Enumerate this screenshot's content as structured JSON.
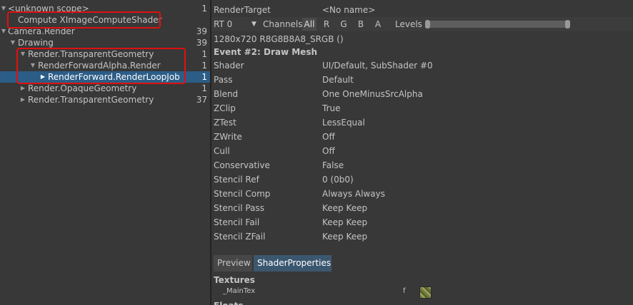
{
  "hierarchy": {
    "rows": [
      {
        "label": "<unknown scope>",
        "count": "1",
        "arrow": "▼"
      },
      {
        "label": "Compute XImageComputeShader",
        "count": "",
        "arrow": ""
      },
      {
        "label": "Camera.Render",
        "count": "39",
        "arrow": "▼"
      },
      {
        "label": "Drawing",
        "count": "39",
        "arrow": "▼"
      },
      {
        "label": "Render.TransparentGeometry",
        "count": "1",
        "arrow": "▼"
      },
      {
        "label": "RenderForwardAlpha.Render",
        "count": "1",
        "arrow": "▼"
      },
      {
        "label": "RenderForward.RenderLoopJob",
        "count": "1",
        "arrow": "▶"
      },
      {
        "label": "Render.OpaqueGeometry",
        "count": "1",
        "arrow": "▶"
      },
      {
        "label": "Render.TransparentGeometry",
        "count": "37",
        "arrow": "▶"
      }
    ]
  },
  "details": {
    "render_target_label": "RenderTarget",
    "render_target_value": "<No name>",
    "toolbar": {
      "rt_label": "RT 0",
      "rt_arrow": "▼",
      "channels_label": "Channels",
      "channel_buttons": [
        "All",
        "R",
        "G",
        "B",
        "A"
      ],
      "levels_label": "Levels"
    },
    "format": "1280x720 R8G8B8A8_SRGB ()",
    "event_title": "Event #2: Draw Mesh",
    "properties": [
      {
        "key": "Shader",
        "value": "UI/Default, SubShader #0"
      },
      {
        "key": "Pass",
        "value": "Default"
      },
      {
        "key": "Blend",
        "value": "One OneMinusSrcAlpha"
      },
      {
        "key": "ZClip",
        "value": "True"
      },
      {
        "key": "ZTest",
        "value": "LessEqual"
      },
      {
        "key": "ZWrite",
        "value": "Off"
      },
      {
        "key": "Cull",
        "value": "Off"
      },
      {
        "key": "Conservative",
        "value": "False"
      },
      {
        "key": "Stencil Ref",
        "value": "0 (0b0)"
      },
      {
        "key": "Stencil Comp",
        "value": "Always Always"
      },
      {
        "key": "Stencil Pass",
        "value": "Keep Keep"
      },
      {
        "key": "Stencil Fail",
        "value": "Keep Keep"
      },
      {
        "key": "Stencil ZFail",
        "value": "Keep Keep"
      }
    ],
    "tabs": [
      "Preview",
      "ShaderProperties"
    ],
    "textures_heading": "Textures",
    "texture": {
      "name": "_MainTex",
      "stage": "f"
    },
    "floats_heading": "Floats"
  },
  "colors": {
    "selection": "#2c5d87",
    "highlight_box": "#e01010",
    "active_tab": "#3b5770"
  }
}
